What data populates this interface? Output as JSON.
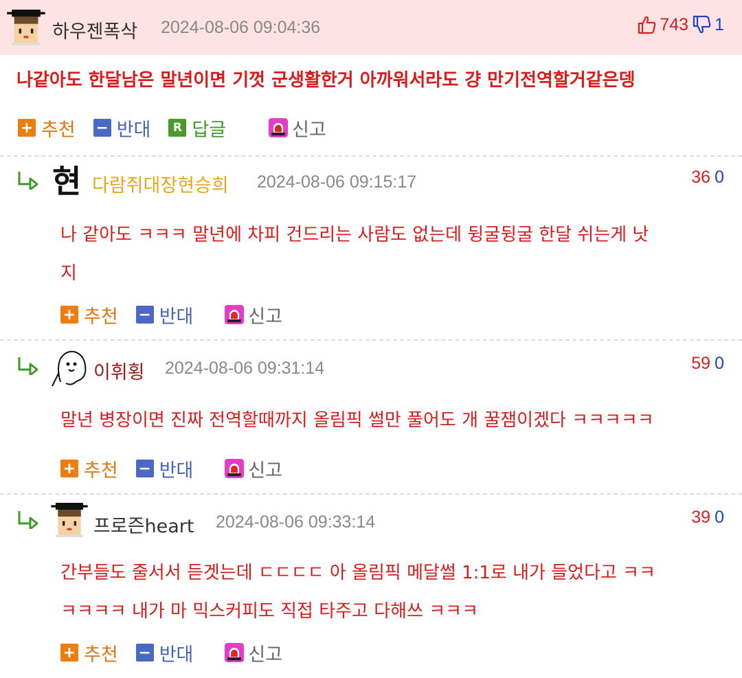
{
  "top_comment": {
    "author": "하우젠폭삭",
    "timestamp": "2024-08-06 09:04:36",
    "likes": "743",
    "dislikes": "1",
    "body": "나같아도 한달남은 말년이면 기껏 군생활한거 아까워서라도 걍 만기전역할거같은뎅",
    "actions": {
      "recommend": "추천",
      "oppose": "반대",
      "reply": "답글",
      "report": "신고"
    },
    "reply_badge": "R",
    "avatar_icon": "pixel-graduate-avatar-icon"
  },
  "replies": [
    {
      "author": "다람쥐대장현승희",
      "author_color": "#e6a817",
      "timestamp": "2024-08-06 09:15:17",
      "likes": "36",
      "dislikes": "0",
      "body_lines": [
        "나 같아도 ㅋㅋㅋ 말년에 차피 건드리는 사람도 없는데 뒹굴뒹굴 한달 쉬는게 낫",
        "지"
      ],
      "avatar_text": "현",
      "actions": {
        "recommend": "추천",
        "oppose": "반대",
        "report": "신고"
      }
    },
    {
      "author": "이휘횡",
      "author_color": "#a01a1a",
      "timestamp": "2024-08-06 09:31:14",
      "likes": "59",
      "dislikes": "0",
      "body_lines": [
        "말년 병장이면 진짜 전역할때까지 올림픽 썰만 풀어도 개 꿀잼이겠다 ㅋㅋㅋㅋㅋ"
      ],
      "avatar_icon": "ghost-avatar-icon",
      "actions": {
        "recommend": "추천",
        "oppose": "반대",
        "report": "신고"
      }
    },
    {
      "author": "프로즌heart",
      "author_color": "#333333",
      "timestamp": "2024-08-06 09:33:14",
      "likes": "39",
      "dislikes": "0",
      "body_lines": [
        "간부들도 줄서서 듣겟는데 ㄷㄷㄷㄷ 아 올림픽 메달썰 1:1로 내가 들었다고 ㅋㅋ",
        "ㅋㅋㅋㅋ 내가 마 믹스커피도 직접 타주고 다해쓰 ㅋㅋㅋ"
      ],
      "avatar_icon": "pixel-graduate-avatar-icon",
      "actions": {
        "recommend": "추천",
        "oppose": "반대",
        "report": "신고"
      }
    }
  ],
  "icons": {
    "plus": "+",
    "minus": "−",
    "thumbs_up": "thumbs-up-icon",
    "thumbs_down": "thumbs-down-icon",
    "reply_arrow": "reply-arrow-icon",
    "siren": "siren-icon"
  },
  "colors": {
    "header_bg": "#fde3e3",
    "comment_text": "#d91b1b",
    "recommend": "#e07612",
    "oppose": "#4562c0",
    "reply": "#409a28",
    "report_icon": "#e63cc8"
  }
}
